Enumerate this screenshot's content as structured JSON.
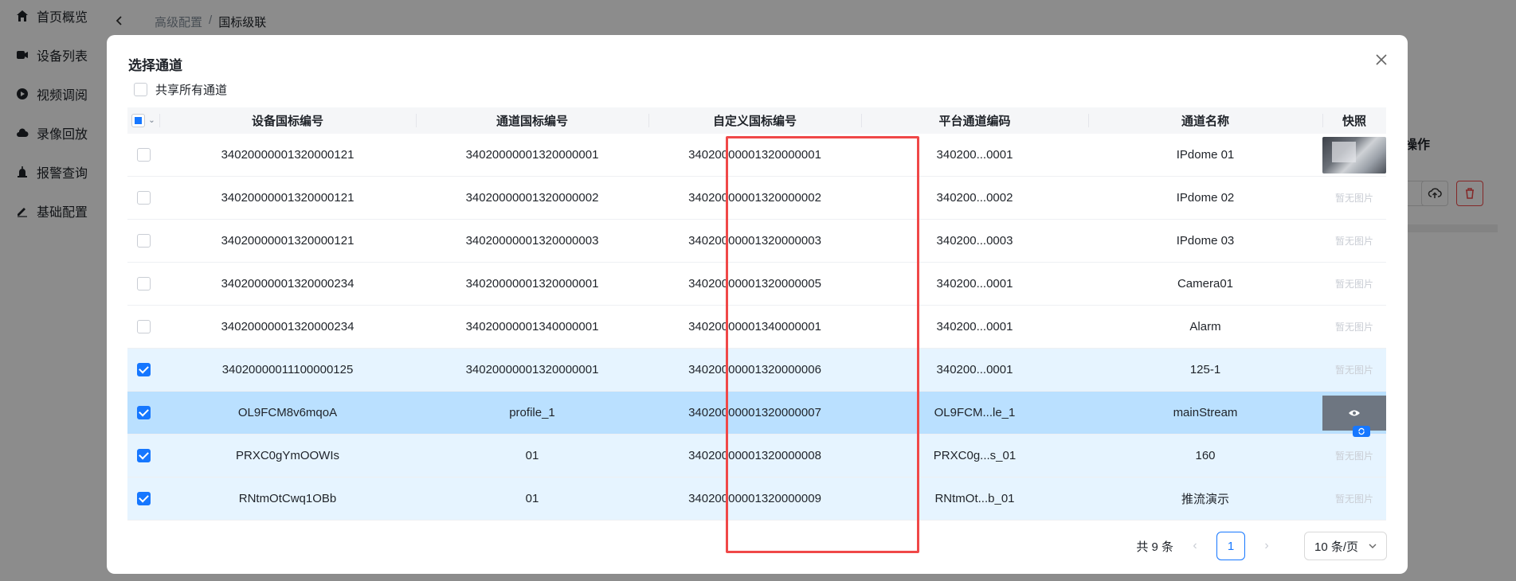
{
  "sidebar": {
    "items": [
      {
        "label": "首页概览",
        "icon": "home-icon"
      },
      {
        "label": "设备列表",
        "icon": "camera-icon"
      },
      {
        "label": "视频调阅",
        "icon": "play-icon"
      },
      {
        "label": "录像回放",
        "icon": "cloud-icon"
      },
      {
        "label": "报警查询",
        "icon": "alarm-icon"
      },
      {
        "label": "基础配置",
        "icon": "edit-icon"
      }
    ]
  },
  "breadcrumb": {
    "parent": "高级配置",
    "separator": "/",
    "current": "国标级联"
  },
  "background": {
    "operation_label": "操作"
  },
  "modal": {
    "title": "选择通道",
    "share_all_label": "共享所有通道",
    "columns": [
      "设备国标编号",
      "通道国标编号",
      "自定义国标编号",
      "平台通道编码",
      "通道名称",
      "快照"
    ],
    "rows": [
      {
        "device": "34020000001320000121",
        "channel": "34020000001320000001",
        "custom": "34020000001320000001",
        "platform": "340200...0001",
        "name": "IPdome 01",
        "checked": false,
        "snapshot": "image"
      },
      {
        "device": "34020000001320000121",
        "channel": "34020000001320000002",
        "custom": "34020000001320000002",
        "platform": "340200...0002",
        "name": "IPdome 02",
        "checked": false,
        "snapshot": "暂无图片"
      },
      {
        "device": "34020000001320000121",
        "channel": "34020000001320000003",
        "custom": "34020000001320000003",
        "platform": "340200...0003",
        "name": "IPdome 03",
        "checked": false,
        "snapshot": "暂无图片"
      },
      {
        "device": "34020000001320000234",
        "channel": "34020000001320000001",
        "custom": "34020000001320000005",
        "platform": "340200...0001",
        "name": "Camera01",
        "checked": false,
        "snapshot": "暂无图片"
      },
      {
        "device": "34020000001320000234",
        "channel": "34020000001340000001",
        "custom": "34020000001340000001",
        "platform": "340200...0001",
        "name": "Alarm",
        "checked": false,
        "snapshot": "暂无图片"
      },
      {
        "device": "34020000011100000125",
        "channel": "34020000001320000001",
        "custom": "34020000001320000006",
        "platform": "340200...0001",
        "name": "125-1",
        "checked": true,
        "snapshot": "暂无图片"
      },
      {
        "device": "OL9FCM8v6mqoA",
        "channel": "profile_1",
        "custom": "34020000001320000007",
        "platform": "OL9FCM...le_1",
        "name": "mainStream",
        "checked": true,
        "snapshot": "hover"
      },
      {
        "device": "PRXC0gYmOOWIs",
        "channel": "01",
        "custom": "34020000001320000008",
        "platform": "PRXC0g...s_01",
        "name": "160",
        "checked": true,
        "snapshot": "暂无图片"
      },
      {
        "device": "RNtmOtCwq1OBb",
        "channel": "01",
        "custom": "34020000001320000009",
        "platform": "RNtmOt...b_01",
        "name": "推流演示",
        "checked": true,
        "snapshot": "暂无图片"
      }
    ]
  },
  "pagination": {
    "total": "共 9 条",
    "current": "1",
    "page_size": "10 条/页"
  },
  "colors": {
    "primary": "#1677ff",
    "highlight": "#f04848",
    "selected_row": "#e6f4ff",
    "active_row": "#bae0ff"
  }
}
